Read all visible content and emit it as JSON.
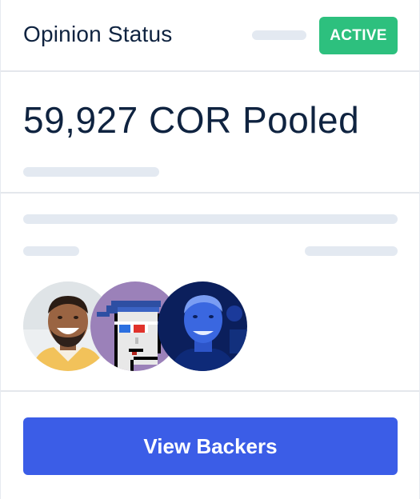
{
  "header": {
    "title": "Opinion Status",
    "status_badge": "ACTIVE"
  },
  "pool": {
    "amount_text": "59,927 COR Pooled"
  },
  "backers": {
    "avatars": [
      {
        "icon": "person-photo-smiling-man"
      },
      {
        "icon": "pixel-art-punk-3d-glasses"
      },
      {
        "icon": "person-photo-blue-tint"
      }
    ],
    "view_button_label": "View Backers"
  },
  "colors": {
    "active_badge": "#2dc07e",
    "primary_button": "#3b5de7",
    "skeleton": "#e3e9f1",
    "text": "#0f2340"
  }
}
